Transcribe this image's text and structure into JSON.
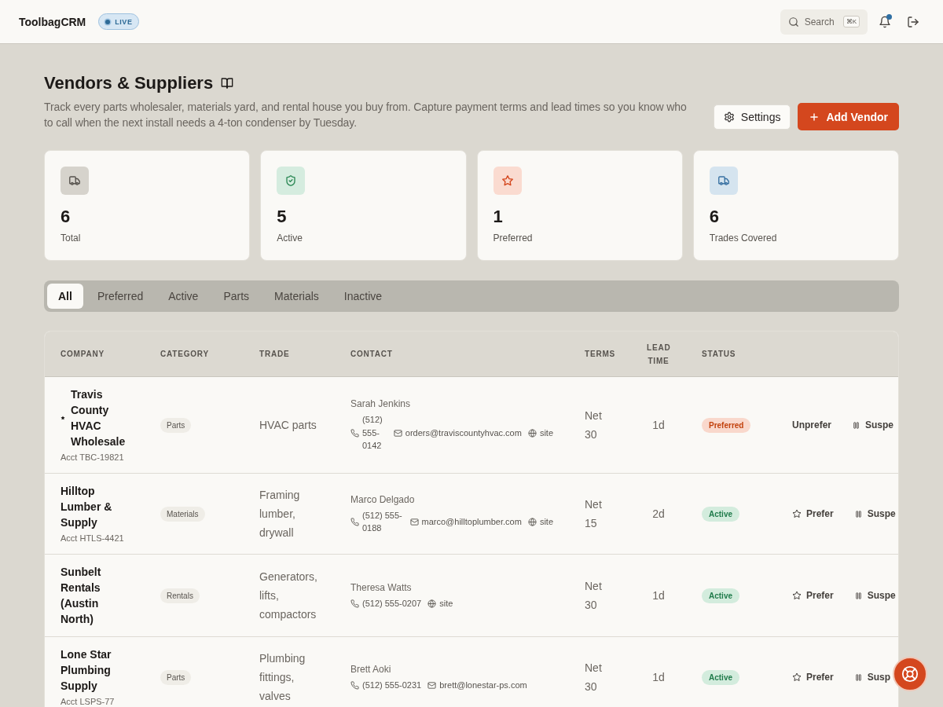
{
  "header": {
    "logo": "ToolbagCRM",
    "badge": "LIVE",
    "search": {
      "label": "Search",
      "shortcut": "⌘K"
    },
    "notifications": {
      "unread": true
    }
  },
  "page": {
    "title": "Vendors & Suppliers",
    "description": "Track every parts wholesaler, materials yard, and rental house you buy from. Capture payment terms and lead times so you know who to call when the next install needs a 4-ton condenser by Tuesday.",
    "buttons": [
      {
        "label": "Settings",
        "kind": "secondary"
      },
      {
        "label": "Add Vendor",
        "kind": "primary"
      }
    ]
  },
  "stats": [
    {
      "value": "6",
      "label": "Total",
      "kind": "total",
      "color": "#d6d3cc"
    },
    {
      "value": "5",
      "label": "Active",
      "kind": "active",
      "color": "#d5ecdf"
    },
    {
      "value": "1",
      "label": "Preferred",
      "kind": "preferred",
      "color": "#fadbd0"
    },
    {
      "value": "6",
      "label": "Trades Covered",
      "kind": "trades",
      "color": "#d5e4ef"
    }
  ],
  "tabs": [
    {
      "label": "All",
      "selected": true
    },
    {
      "label": "Preferred",
      "selected": false
    },
    {
      "label": "Active",
      "selected": false
    },
    {
      "label": "Parts",
      "selected": false
    },
    {
      "label": "Materials",
      "selected": false
    },
    {
      "label": "Inactive",
      "selected": false
    }
  ],
  "table": {
    "columns": [
      "COMPANY",
      "CATEGORY",
      "TRADE",
      "CONTACT",
      "TERMS",
      "LEAD TIME",
      "STATUS"
    ],
    "rows": [
      {
        "company": "Travis County HVAC Wholesale",
        "account": "Acct TBC-19821",
        "preferred": true,
        "category": "Parts",
        "trade": "HVAC parts",
        "contact": {
          "name": "Sarah Jenkins",
          "phone": "(512) 555-0142",
          "email": "orders@traviscountyhvac.com",
          "site": "site"
        },
        "terms": "Net 30",
        "lead_time": "1d",
        "status": {
          "label": "Preferred",
          "kind": "preferred"
        },
        "actions": [
          "Unprefer",
          "Suspe"
        ]
      },
      {
        "company": "Hilltop Lumber & Supply",
        "account": "Acct HTLS-4421",
        "preferred": false,
        "category": "Materials",
        "trade": "Framing lumber, drywall",
        "contact": {
          "name": "Marco Delgado",
          "phone": "(512) 555-0188",
          "email": "marco@hilltoplumber.com",
          "site": "site"
        },
        "terms": "Net 15",
        "lead_time": "2d",
        "status": {
          "label": "Active",
          "kind": "active"
        },
        "actions": [
          "Prefer",
          "Suspe"
        ]
      },
      {
        "company": "Sunbelt Rentals (Austin North)",
        "preferred": false,
        "category": "Rentals",
        "trade": "Generators, lifts, compactors",
        "contact": {
          "name": "Theresa Watts",
          "phone": "(512) 555-0207",
          "site": "site"
        },
        "terms": "Net 30",
        "lead_time": "1d",
        "status": {
          "label": "Active",
          "kind": "active"
        },
        "actions": [
          "Prefer",
          "Suspe"
        ]
      },
      {
        "company": "Lone Star Plumbing Supply",
        "account": "Acct LSPS-77",
        "preferred": false,
        "category": "Parts",
        "trade": "Plumbing fittings, valves",
        "contact": {
          "name": "Brett Aoki",
          "phone": "(512) 555-0231",
          "email": "brett@lonestar-ps.com"
        },
        "terms": "Net 30",
        "lead_time": "1d",
        "status": {
          "label": "Active",
          "kind": "active"
        },
        "actions": [
          "Prefer",
          "Susp"
        ]
      }
    ]
  }
}
